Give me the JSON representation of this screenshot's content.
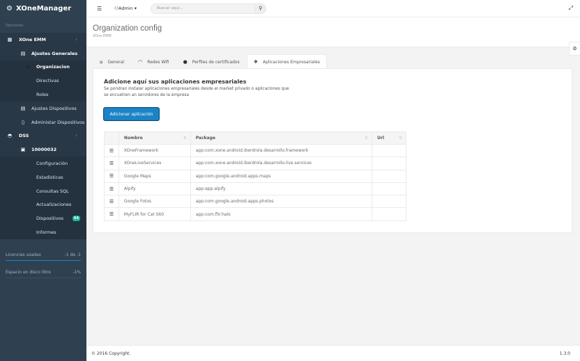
{
  "app": {
    "brand_icon": "gear-icon",
    "title": "XOneManager"
  },
  "sidebar": {
    "section_label": "Opciones",
    "items": [
      {
        "label": "XOne EMM",
        "icon": "table-icon",
        "level": 0
      },
      {
        "label": "Ajustes Generales",
        "icon": "list-icon",
        "level": 1
      },
      {
        "label": "Organizacion",
        "icon": "building-icon",
        "level": 2
      },
      {
        "label": "Directivas",
        "icon": "key-icon",
        "level": 2
      },
      {
        "label": "Roles",
        "icon": "users-icon",
        "level": 2
      },
      {
        "label": "Ajustes Dispositivos",
        "icon": "list-icon",
        "level": 1
      },
      {
        "label": "Administar Dispositivos",
        "icon": "mobile-icon",
        "level": 1
      },
      {
        "label": "DSS",
        "icon": "dashboard-icon",
        "level": 0
      },
      {
        "label": "10000032",
        "icon": "server-icon",
        "level": 1
      },
      {
        "label": "Configuración",
        "icon": "wrench-icon",
        "level": 2
      },
      {
        "label": "Estadisticas",
        "icon": "chart-icon",
        "level": 2
      },
      {
        "label": "Consultas SQL",
        "icon": "database-icon",
        "level": 2
      },
      {
        "label": "Actualizaciones",
        "icon": "refresh-icon",
        "level": 2
      },
      {
        "label": "Dispositivos",
        "icon": "mobile-icon",
        "level": 2,
        "badge": "64"
      },
      {
        "label": "Informes",
        "icon": "file-icon",
        "level": 2
      }
    ],
    "stats": [
      {
        "label": "Licencias usadas",
        "value": "-1 de -1",
        "fill": 1.0
      },
      {
        "label": "Espacio en disco libre",
        "value": "-1%",
        "fill": 0
      }
    ]
  },
  "topbar": {
    "menu_icon": "bars-icon",
    "user_label": "Admin",
    "search_placeholder": "Buscar aqui...",
    "search_icon": "search-icon",
    "expand_icon": "expand-icon"
  },
  "heading": {
    "title": "Organization config",
    "breadcrumb": "XOne EMM"
  },
  "tabs": [
    {
      "label": "General",
      "icon": "bank-icon",
      "active": false
    },
    {
      "label": "Redes Wifi",
      "icon": "wifi-icon",
      "active": false
    },
    {
      "label": "Perfiles de certificados",
      "icon": "certificate-icon",
      "active": false
    },
    {
      "label": "Aplicaciones Empresariales",
      "icon": "cubes-icon",
      "active": true
    }
  ],
  "panel": {
    "title": "Adicione aquí sus aplicaciones empresariales",
    "description": "Se pondran instalar aplicaciones empresariales desde el market privado o aplicaciones que se encuetren an servidores de la empresa",
    "add_button": "Adicionar aplicación"
  },
  "table": {
    "columns": [
      "",
      "Nombre",
      "Package",
      "Url"
    ],
    "rows": [
      {
        "name": "XOneFramework",
        "package": "app:com.xone.android.iberdrola.desarrollo.framework",
        "url": ""
      },
      {
        "name": "XOneLiveServices",
        "package": "app:com.xone.android.iberdrola.desarrollo.live.services",
        "url": ""
      },
      {
        "name": "Google Maps",
        "package": "app:com.google.android.apps.maps",
        "url": ""
      },
      {
        "name": "Alpify",
        "package": "app:app.alpify",
        "url": ""
      },
      {
        "name": "Google Fotos",
        "package": "app:com.google.android.apps.photos",
        "url": ""
      },
      {
        "name": "MyFLIR for Cat S60",
        "package": "app:com.flir.halo",
        "url": ""
      }
    ]
  },
  "footer": {
    "copyright": "© 2016 Copyright.",
    "version": "1.3.0"
  },
  "colors": {
    "sidebar": "#2f4050",
    "primary": "#1c84c6",
    "badge": "#1ab394"
  }
}
